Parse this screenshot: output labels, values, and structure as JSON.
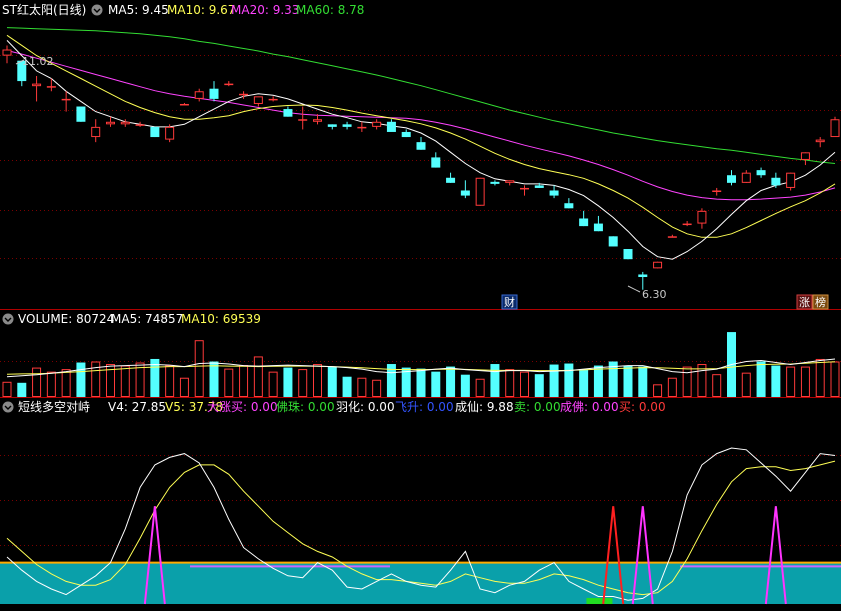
{
  "colors": {
    "background": "#000000",
    "up": "#ff3a3a",
    "down": "#54ffff",
    "ma5": "#ffffff",
    "ma10": "#ffff55",
    "ma20": "#ff44ff",
    "ma60": "#33dd33",
    "separator": "#b00000",
    "grid": "#7a0000",
    "fill_band": "#0aa0aa",
    "line_orange": "#ffaa00",
    "label_gray": "#c8c8c8"
  },
  "price_panel": {
    "title": "ST红太阳(日线)",
    "ma5_label": "MA5: 9.45",
    "ma10_label": "MA10: 9.67",
    "ma20_label": "MA20: 9.33",
    "ma60_label": "MA60: 8.78",
    "high_annotation": "11.02",
    "low_annotation": "6.30",
    "badge_cai": "财",
    "badge_zhang": "涨",
    "badge_bang": "榜",
    "ylim": [
      6.0,
      11.6
    ]
  },
  "volume_panel": {
    "vol_label": "VOLUME: 80724",
    "ma5_label": "MA5: 74857",
    "ma10_label": "MA10: 69539",
    "ylim": [
      0,
      140000
    ]
  },
  "indicator_panel": {
    "title": "短线多空对峙",
    "v4_label": "V4: 27.85",
    "v5_label": "V5: 37.78",
    "dazhangmai_label": "大涨买: 0.00",
    "fozhu_label": "佛珠: 0.00",
    "yuhua_label": "羽化: 0.00",
    "feisheng_label": "飞升: 0.00",
    "chengxian_label": "成仙: 9.88",
    "mai_sell_label": "卖: 0.00",
    "chengfo_label": "成佛: 0.00",
    "mai_buy_label": "买: 0.00",
    "ylim": [
      0,
      100
    ]
  },
  "chart_data": {
    "type": "candlestick",
    "candles": [
      [
        10.9,
        11.1,
        10.75,
        11.02
      ],
      [
        10.8,
        10.8,
        10.3,
        10.4
      ],
      [
        10.3,
        10.5,
        10.0,
        10.35
      ],
      [
        10.3,
        10.45,
        10.2,
        10.3
      ],
      [
        10.05,
        10.2,
        9.8,
        10.05
      ],
      [
        9.9,
        9.9,
        9.6,
        9.6
      ],
      [
        9.3,
        9.65,
        9.2,
        9.5
      ],
      [
        9.55,
        9.7,
        9.5,
        9.6
      ],
      [
        9.55,
        9.65,
        9.5,
        9.6
      ],
      [
        9.55,
        9.6,
        9.5,
        9.55
      ],
      [
        9.5,
        9.5,
        9.3,
        9.3
      ],
      [
        9.25,
        9.55,
        9.2,
        9.5
      ],
      [
        9.95,
        9.97,
        9.93,
        9.95
      ],
      [
        10.05,
        10.25,
        10.0,
        10.2
      ],
      [
        10.25,
        10.4,
        10.0,
        10.05
      ],
      [
        10.35,
        10.4,
        10.3,
        10.35
      ],
      [
        10.15,
        10.2,
        10.05,
        10.15
      ],
      [
        9.95,
        10.05,
        9.9,
        10.1
      ],
      [
        10.05,
        10.1,
        10.0,
        10.05
      ],
      [
        9.85,
        9.9,
        9.7,
        9.7
      ],
      [
        9.65,
        9.9,
        9.45,
        9.65
      ],
      [
        9.6,
        9.75,
        9.55,
        9.65
      ],
      [
        9.55,
        9.55,
        9.45,
        9.5
      ],
      [
        9.55,
        9.6,
        9.45,
        9.5
      ],
      [
        9.5,
        9.6,
        9.4,
        9.5
      ],
      [
        9.5,
        9.65,
        9.45,
        9.6
      ],
      [
        9.6,
        9.65,
        9.45,
        9.4
      ],
      [
        9.4,
        9.45,
        9.3,
        9.3
      ],
      [
        9.2,
        9.3,
        9.05,
        9.05
      ],
      [
        8.9,
        9.0,
        8.7,
        8.7
      ],
      [
        8.5,
        8.6,
        8.4,
        8.4
      ],
      [
        8.25,
        8.45,
        8.1,
        8.15
      ],
      [
        7.95,
        8.5,
        7.95,
        8.5
      ],
      [
        8.42,
        8.45,
        8.35,
        8.38
      ],
      [
        8.4,
        8.45,
        8.35,
        8.45
      ],
      [
        8.3,
        8.35,
        8.15,
        8.3
      ],
      [
        8.35,
        8.4,
        8.3,
        8.3
      ],
      [
        8.25,
        8.35,
        8.1,
        8.15
      ],
      [
        8.0,
        8.1,
        7.9,
        7.9
      ],
      [
        7.7,
        7.85,
        7.55,
        7.55
      ],
      [
        7.6,
        7.75,
        7.45,
        7.45
      ],
      [
        7.35,
        7.35,
        7.15,
        7.15
      ],
      [
        7.1,
        7.1,
        6.9,
        6.9
      ],
      [
        6.6,
        6.65,
        6.3,
        6.55
      ],
      [
        6.72,
        6.85,
        6.72,
        6.85
      ],
      [
        7.35,
        7.38,
        7.33,
        7.35
      ],
      [
        7.6,
        7.65,
        7.55,
        7.6
      ],
      [
        7.6,
        7.9,
        7.5,
        7.85
      ],
      [
        8.25,
        8.3,
        8.15,
        8.25
      ],
      [
        8.55,
        8.65,
        8.35,
        8.4
      ],
      [
        8.4,
        8.65,
        8.4,
        8.6
      ],
      [
        8.65,
        8.7,
        8.5,
        8.55
      ],
      [
        8.5,
        8.6,
        8.3,
        8.35
      ],
      [
        8.3,
        8.6,
        8.25,
        8.6
      ],
      [
        8.85,
        9.0,
        8.75,
        9.0
      ],
      [
        9.2,
        9.3,
        9.1,
        9.25
      ],
      [
        9.3,
        9.7,
        9.3,
        9.65
      ]
    ],
    "ma5": [
      11.2,
      10.9,
      10.6,
      10.45,
      10.2,
      10.0,
      9.8,
      9.7,
      9.6,
      9.55,
      9.5,
      9.5,
      9.55,
      9.7,
      9.85,
      10.0,
      10.1,
      10.15,
      10.12,
      10.05,
      9.95,
      9.85,
      9.75,
      9.68,
      9.6,
      9.57,
      9.52,
      9.48,
      9.38,
      9.22,
      9.0,
      8.78,
      8.6,
      8.48,
      8.43,
      8.38,
      8.38,
      8.35,
      8.27,
      8.15,
      7.95,
      7.72,
      7.45,
      7.15,
      6.95,
      6.9,
      7.05,
      7.25,
      7.5,
      7.78,
      8.05,
      8.25,
      8.35,
      8.42,
      8.55,
      8.75,
      9.0
    ],
    "ma10": [
      11.3,
      11.1,
      10.9,
      10.75,
      10.6,
      10.45,
      10.3,
      10.15,
      10.0,
      9.88,
      9.78,
      9.7,
      9.65,
      9.65,
      9.68,
      9.72,
      9.8,
      9.86,
      9.9,
      9.92,
      9.93,
      9.92,
      9.88,
      9.83,
      9.77,
      9.72,
      9.67,
      9.62,
      9.56,
      9.48,
      9.38,
      9.26,
      9.12,
      8.98,
      8.86,
      8.76,
      8.68,
      8.62,
      8.56,
      8.49,
      8.38,
      8.25,
      8.1,
      7.92,
      7.72,
      7.53,
      7.4,
      7.33,
      7.33,
      7.4,
      7.52,
      7.66,
      7.8,
      7.93,
      8.05,
      8.2,
      8.38
    ],
    "ma20": [
      11.0,
      10.93,
      10.85,
      10.77,
      10.69,
      10.61,
      10.53,
      10.45,
      10.37,
      10.29,
      10.21,
      10.15,
      10.1,
      10.06,
      10.02,
      9.98,
      9.93,
      9.88,
      9.83,
      9.78,
      9.75,
      9.73,
      9.72,
      9.71,
      9.7,
      9.69,
      9.68,
      9.67,
      9.64,
      9.59,
      9.53,
      9.46,
      9.38,
      9.3,
      9.22,
      9.14,
      9.07,
      9.0,
      8.93,
      8.85,
      8.76,
      8.66,
      8.55,
      8.43,
      8.32,
      8.23,
      8.16,
      8.11,
      8.08,
      8.07,
      8.07,
      8.08,
      8.1,
      8.12,
      8.16,
      8.22,
      8.3
    ],
    "ma60": [
      11.45,
      11.44,
      11.43,
      11.42,
      11.41,
      11.4,
      11.39,
      11.37,
      11.35,
      11.33,
      11.3,
      11.27,
      11.23,
      11.18,
      11.14,
      11.09,
      11.04,
      10.99,
      10.93,
      10.88,
      10.82,
      10.76,
      10.7,
      10.64,
      10.58,
      10.52,
      10.45,
      10.38,
      10.31,
      10.23,
      10.15,
      10.07,
      9.99,
      9.91,
      9.83,
      9.76,
      9.69,
      9.62,
      9.56,
      9.5,
      9.44,
      9.38,
      9.33,
      9.28,
      9.23,
      9.19,
      9.15,
      9.11,
      9.07,
      9.04,
      9.0,
      8.96,
      8.92,
      8.88,
      8.85,
      8.81,
      8.78
    ],
    "volume": [
      30000,
      28000,
      58000,
      50000,
      55000,
      68000,
      70000,
      65000,
      62000,
      68000,
      75000,
      62000,
      38000,
      112000,
      70000,
      56000,
      63000,
      80000,
      50000,
      58000,
      55000,
      65000,
      60000,
      40000,
      38000,
      34000,
      65000,
      58000,
      56000,
      50000,
      60000,
      44000,
      36000,
      65000,
      55000,
      50000,
      45000,
      64000,
      66000,
      55000,
      62000,
      70000,
      62000,
      60000,
      25000,
      38000,
      60000,
      65000,
      45000,
      128000,
      48000,
      70000,
      62000,
      60000,
      60000,
      75000,
      70000
    ],
    "vol_ma5": [
      40000,
      42000,
      44000,
      47000,
      50000,
      54000,
      58000,
      61000,
      62000,
      63000,
      64000,
      63000,
      60000,
      66000,
      67000,
      65000,
      62000,
      61000,
      62000,
      63000,
      62000,
      61000,
      60000,
      58000,
      55000,
      50000,
      48000,
      50000,
      52000,
      55000,
      57000,
      54000,
      52000,
      50000,
      52000,
      52000,
      50000,
      51000,
      52000,
      55000,
      58000,
      60000,
      62000,
      62000,
      56000,
      50000,
      48000,
      52000,
      55000,
      64000,
      70000,
      72000,
      68000,
      64000,
      68000,
      72000,
      74857
    ],
    "vol_ma10": [
      45000,
      45500,
      46000,
      47000,
      48500,
      50000,
      52000,
      54000,
      56000,
      58000,
      59000,
      60000,
      60000,
      61000,
      61500,
      61000,
      60500,
      60000,
      60500,
      61000,
      61000,
      60500,
      60000,
      59000,
      57500,
      56000,
      54500,
      54000,
      54000,
      54500,
      55000,
      54500,
      53500,
      52500,
      52500,
      52500,
      52000,
      52000,
      52500,
      53500,
      55000,
      56000,
      57000,
      58000,
      57500,
      56500,
      55500,
      55500,
      56000,
      59000,
      62000,
      64000,
      64500,
      65000,
      66500,
      68000,
      69539
    ],
    "v4": [
      25,
      18,
      12,
      8,
      5,
      10,
      15,
      22,
      40,
      62,
      74,
      78,
      80,
      75,
      62,
      45,
      30,
      24,
      19,
      15,
      14,
      22,
      18,
      9,
      8,
      12,
      16,
      12,
      10,
      9,
      18,
      28,
      8,
      6,
      10,
      12,
      18,
      22,
      12,
      8,
      4,
      4,
      2,
      3,
      8,
      28,
      58,
      74,
      80,
      83,
      82,
      75,
      68,
      60,
      70,
      80,
      79
    ],
    "v5": [
      35,
      28,
      21,
      16,
      12,
      10,
      10,
      13,
      21,
      35,
      50,
      62,
      70,
      74,
      74,
      69,
      60,
      52,
      44,
      38,
      32,
      28,
      25,
      20,
      16,
      13,
      13,
      12,
      11,
      10,
      12,
      16,
      14,
      12,
      11,
      11,
      13,
      16,
      15,
      13,
      10,
      8,
      6,
      5,
      6,
      12,
      24,
      39,
      53,
      65,
      72,
      73,
      73,
      71,
      72,
      74,
      76
    ],
    "signals_magenta": [
      10,
      43,
      52
    ],
    "signals_red": [
      41
    ],
    "signals_green": [
      41
    ]
  }
}
